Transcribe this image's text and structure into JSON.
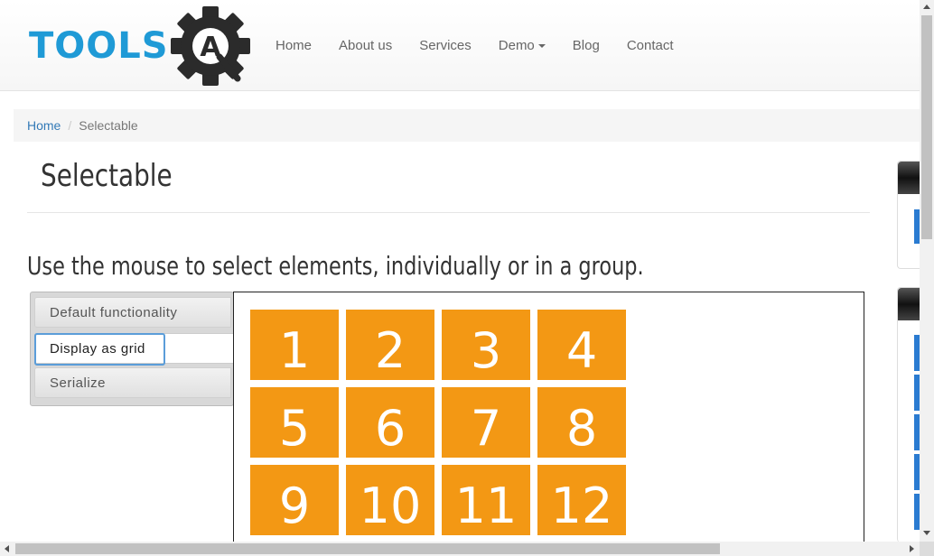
{
  "brand": {
    "logo_text": "TOOLS",
    "gear_letter": "A"
  },
  "nav": {
    "items": [
      {
        "label": "Home"
      },
      {
        "label": "About us"
      },
      {
        "label": "Services"
      },
      {
        "label": "Demo",
        "has_dropdown": true
      },
      {
        "label": "Blog"
      },
      {
        "label": "Contact"
      }
    ]
  },
  "breadcrumb": {
    "home": "Home",
    "separator": "/",
    "current": "Selectable"
  },
  "page": {
    "title": "Selectable",
    "subtitle": "Use the mouse to select elements, individually or in a group."
  },
  "tabs": {
    "items": [
      {
        "label": "Default functionality"
      },
      {
        "label": "Display as grid"
      },
      {
        "label": "Serialize"
      }
    ],
    "active_index": 1
  },
  "grid": {
    "items": [
      "1",
      "2",
      "3",
      "4",
      "5",
      "6",
      "7",
      "8",
      "9",
      "10",
      "11",
      "12"
    ],
    "color": "#f39814"
  },
  "colors": {
    "accent": "#1f9ad6",
    "link": "#337ab7",
    "tile": "#f39814"
  }
}
